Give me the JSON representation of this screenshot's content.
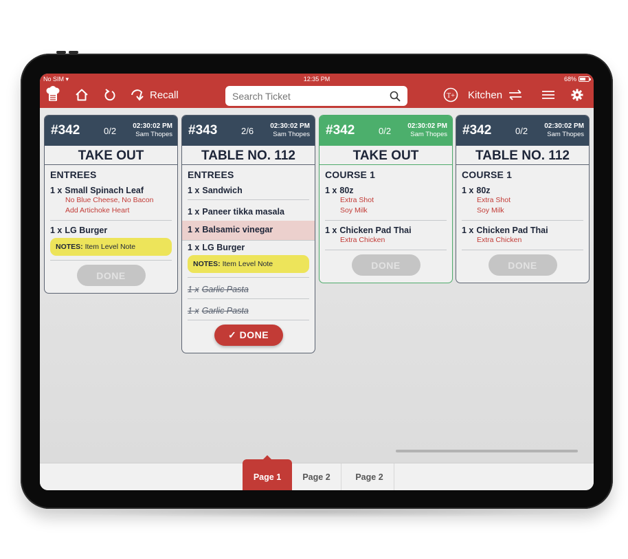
{
  "status_bar": {
    "carrier": "No SIM",
    "time": "12:35 PM",
    "battery_percent": "68%",
    "battery_level": 0.68
  },
  "toolbar": {
    "recall_label": "Recall",
    "search_placeholder": "Search Ticket",
    "search_value": "",
    "station_label": "Kitchen",
    "brand_color": "#c23b36"
  },
  "tickets": [
    {
      "number": "#342",
      "count": "0/2",
      "time": "02:30:02 PM",
      "user": "Sam Thopes",
      "type": "TAKE OUT",
      "section": "ENTREES",
      "items": [
        {
          "qty": "1 x",
          "name": "Small Spinach Leaf",
          "mods": [
            "No Blue Cheese, No Bacon",
            "Add Artichoke Heart"
          ]
        },
        {
          "qty": "1 x",
          "name": "LG  Burger",
          "note_label": "NOTES:",
          "note": "Item Level Note"
        }
      ],
      "done_label": "DONE"
    },
    {
      "number": "#343",
      "count": "2/6",
      "time": "02:30:02 PM",
      "user": "Sam Thopes",
      "type": "TABLE NO. 112",
      "section": "ENTREES",
      "items": [
        {
          "qty": "1 x",
          "name": "Sandwich"
        },
        {
          "qty": "1 x",
          "name": "Paneer tikka masala"
        },
        {
          "qty": "1 x",
          "name": "Balsamic vinegar",
          "state": "highlighted"
        },
        {
          "qty": "1 x",
          "name": "LG  Burger",
          "note_label": "NOTES:",
          "note": "Item Level Note"
        },
        {
          "qty": "1 x",
          "name": "Garlic Pasta",
          "state": "done"
        },
        {
          "qty": "1 x",
          "name": "Garlic Pasta",
          "state": "done"
        }
      ],
      "done_label": "DONE"
    },
    {
      "number": "#342",
      "count": "0/2",
      "time": "02:30:02 PM",
      "user": "Sam Thopes",
      "type": "TAKE OUT",
      "section": "COURSE 1",
      "items": [
        {
          "qty": "1 x",
          "name": "80z",
          "mods": [
            "Extra Shot",
            "Soy Milk"
          ]
        },
        {
          "qty": "1 x",
          "name": "Chicken Pad Thai",
          "mods": [
            "Extra Chicken"
          ]
        }
      ],
      "done_label": "DONE"
    },
    {
      "number": "#342",
      "count": "0/2",
      "time": "02:30:02 PM",
      "user": "Sam Thopes",
      "type": "TABLE NO. 112",
      "section": "COURSE 1",
      "items": [
        {
          "qty": "1 x",
          "name": "80z",
          "mods": [
            "Extra Shot",
            "Soy Milk"
          ]
        },
        {
          "qty": "1 x",
          "name": "Chicken Pad Thai",
          "mods": [
            "Extra Chicken"
          ]
        }
      ],
      "done_label": "DONE"
    }
  ],
  "pager": {
    "tabs": [
      "Page 1",
      "Page 2",
      "Page 2"
    ],
    "active_index": 0
  }
}
